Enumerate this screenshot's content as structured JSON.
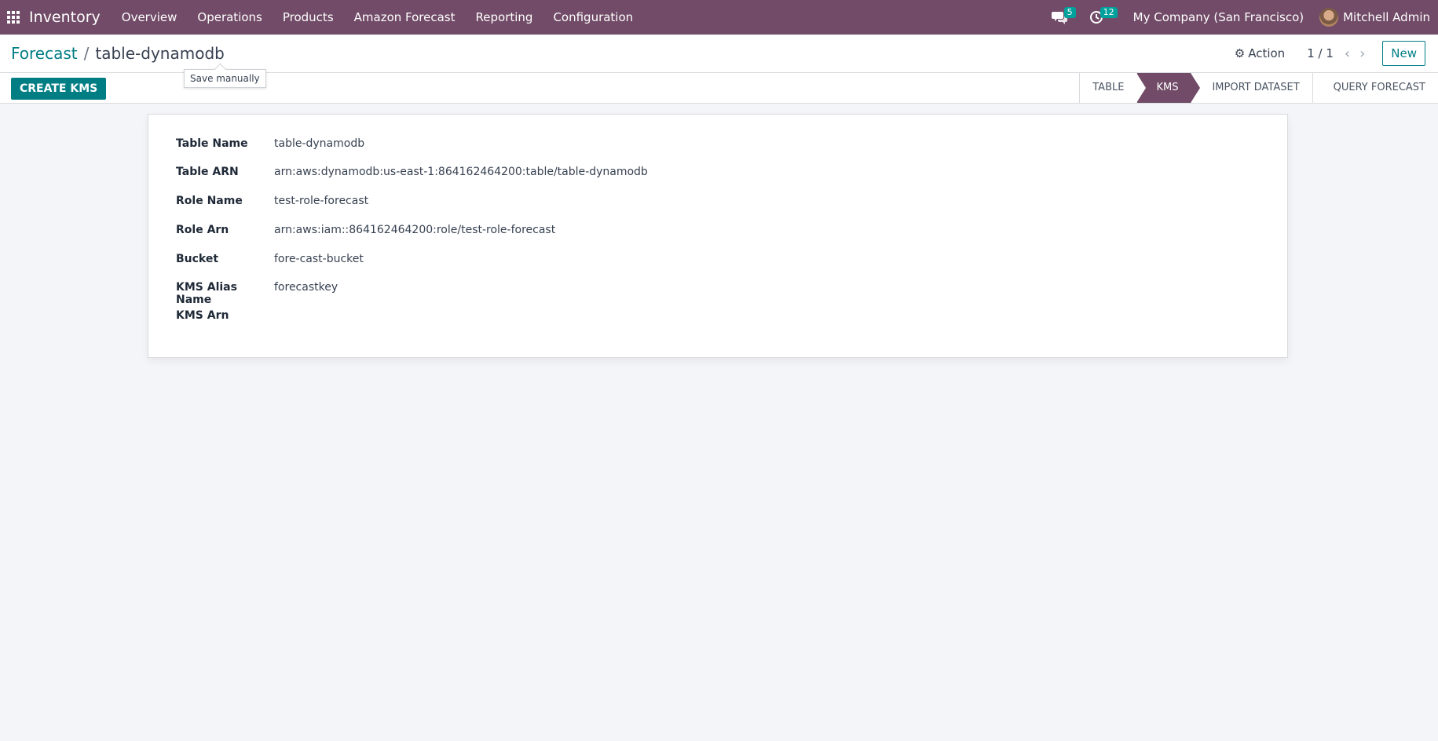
{
  "navbar": {
    "app_name": "Inventory",
    "menu": [
      "Overview",
      "Operations",
      "Products",
      "Amazon Forecast",
      "Reporting",
      "Configuration"
    ],
    "messages_count": "5",
    "activities_count": "12",
    "company": "My Company (San Francisco)",
    "user": "Mitchell Admin",
    "bg_color": "#714b67"
  },
  "breadcrumb": {
    "parent": "Forecast",
    "separator": "/",
    "current": "table-dynamodb"
  },
  "tooltip": "Save manually",
  "control": {
    "action_label": "Action",
    "pager": "1 / 1",
    "new_label": "New"
  },
  "statusbar": {
    "create_button": "CREATE KMS",
    "stages": [
      "TABLE",
      "KMS",
      "IMPORT DATASET",
      "QUERY FORECAST"
    ],
    "active_stage": "KMS"
  },
  "form": {
    "fields": [
      {
        "label": "Table Name",
        "value": "table-dynamodb"
      },
      {
        "label": "Table ARN",
        "value": "arn:aws:dynamodb:us-east-1:864162464200:table/table-dynamodb"
      },
      {
        "label": "Role Name",
        "value": "test-role-forecast"
      },
      {
        "label": "Role Arn",
        "value": "arn:aws:iam::864162464200:role/test-role-forecast"
      },
      {
        "label": "Bucket",
        "value": "fore-cast-bucket"
      },
      {
        "label": "KMS Alias Name",
        "value": "forecastkey"
      },
      {
        "label": "KMS Arn",
        "value": ""
      }
    ]
  }
}
